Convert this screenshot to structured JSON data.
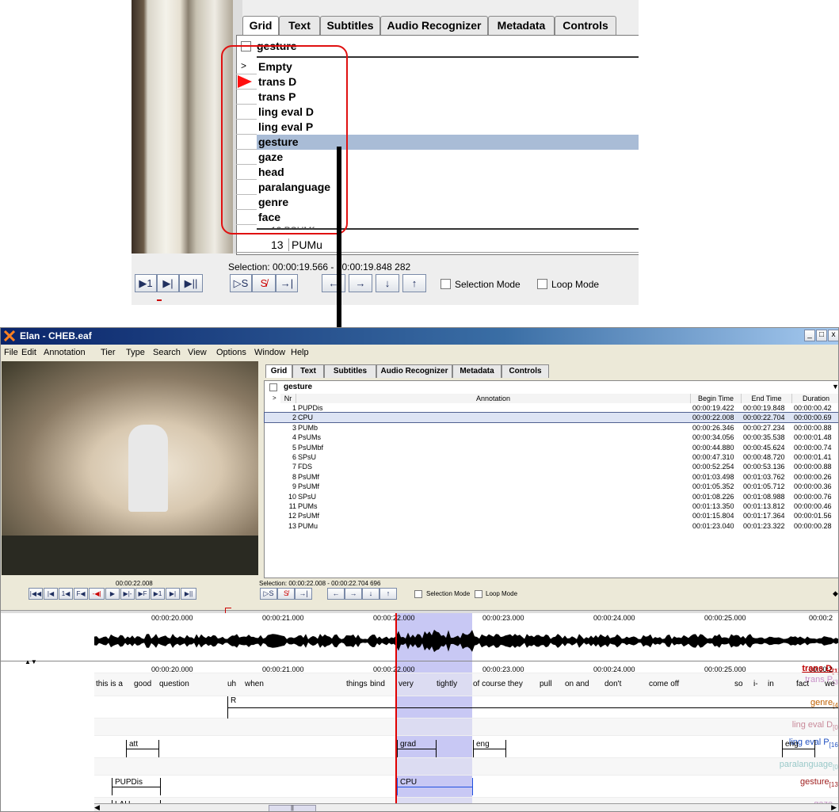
{
  "zoom": {
    "tabs": [
      "Grid",
      "Text",
      "Subtitles",
      "Audio Recognizer",
      "Metadata",
      "Controls"
    ],
    "tier_selected": "gesture",
    "list_first_marker": ">",
    "tier_list": [
      "Empty",
      "trans D",
      "trans P",
      "ling eval D",
      "ling eval P",
      "gesture",
      "gaze",
      "head",
      "paralanguage",
      "genre",
      "face"
    ],
    "highlight_index": 5,
    "partial_row": "12 PSUMf",
    "last_row_nr": "13",
    "last_row_ann": "PUMu",
    "selection": "Selection: 00:00:19.566 - 00:00:19.848  282",
    "nav_buttons": [
      "▶1",
      "▶|",
      "▶||"
    ],
    "sel_buttons": [
      "▷S",
      "S̸",
      "→|"
    ],
    "arrow_buttons": [
      "←",
      "→",
      "↓",
      "↑"
    ],
    "selection_mode": "Selection Mode",
    "loop_mode": "Loop Mode"
  },
  "window": {
    "title": "Elan - CHEB.eaf",
    "win_buttons": [
      "_",
      "□",
      "x"
    ],
    "menu": [
      "File",
      "Edit",
      "Annotation",
      "Tier",
      "Type",
      "Search",
      "View",
      "Options",
      "Window",
      "Help"
    ],
    "tabs": [
      "Grid",
      "Text",
      "Subtitles",
      "Audio Recognizer",
      "Metadata",
      "Controls"
    ],
    "tier_selected": "gesture",
    "headers": [
      "Nr",
      "Annotation",
      "Begin Time",
      "End Time",
      "Duration"
    ],
    "rows": [
      {
        "nr": "1",
        "ann": "PUPDis",
        "begin": "00:00:19.422",
        "end": "00:00:19.848",
        "dur": "00:00:00.42"
      },
      {
        "nr": "2",
        "ann": "CPU",
        "begin": "00:00:22.008",
        "end": "00:00:22.704",
        "dur": "00:00:00.69"
      },
      {
        "nr": "3",
        "ann": "PUMb",
        "begin": "00:00:26.346",
        "end": "00:00:27.234",
        "dur": "00:00:00.88"
      },
      {
        "nr": "4",
        "ann": "PsUMs",
        "begin": "00:00:34.056",
        "end": "00:00:35.538",
        "dur": "00:00:01.48"
      },
      {
        "nr": "5",
        "ann": "PsUMbf",
        "begin": "00:00:44.880",
        "end": "00:00:45.624",
        "dur": "00:00:00.74"
      },
      {
        "nr": "6",
        "ann": "SPsU",
        "begin": "00:00:47.310",
        "end": "00:00:48.720",
        "dur": "00:00:01.41"
      },
      {
        "nr": "7",
        "ann": "FDS",
        "begin": "00:00:52.254",
        "end": "00:00:53.136",
        "dur": "00:00:00.88"
      },
      {
        "nr": "8",
        "ann": "PsUMf",
        "begin": "00:01:03.498",
        "end": "00:01:03.762",
        "dur": "00:00:00.26"
      },
      {
        "nr": "9",
        "ann": "PsUMf",
        "begin": "00:01:05.352",
        "end": "00:01:05.712",
        "dur": "00:00:00.36"
      },
      {
        "nr": "10",
        "ann": "SPsU",
        "begin": "00:01:08.226",
        "end": "00:01:08.988",
        "dur": "00:00:00.76"
      },
      {
        "nr": "11",
        "ann": "PUMs",
        "begin": "00:01:13.350",
        "end": "00:01:13.812",
        "dur": "00:00:00.46"
      },
      {
        "nr": "12",
        "ann": "PsUMf",
        "begin": "00:01:15.804",
        "end": "00:01:17.364",
        "dur": "00:00:01.56"
      },
      {
        "nr": "13",
        "ann": "PUMu",
        "begin": "00:01:23.040",
        "end": "00:01:23.322",
        "dur": "00:00:00.28"
      }
    ],
    "current_time": "00:00:22.008",
    "selection": "Selection: 00:00:22.008 - 00:00:22.704  696",
    "player_buttons": [
      "|◀◀",
      "|◀",
      "1◀",
      "F◀",
      "-◀|",
      "▶",
      "▶|-",
      "▶F",
      "▶1",
      "▶|",
      "▶||"
    ],
    "sel_buttons": [
      "▷S",
      "S̸",
      "→|"
    ],
    "arrow_buttons": [
      "←",
      "→",
      "↓",
      "↑"
    ],
    "selection_mode": "Selection Mode",
    "loop_mode": "Loop Mode",
    "ruler_times": [
      "00:00:20.000",
      "00:00:21.000",
      "00:00:22.000",
      "00:00:23.000",
      "00:00:24.000",
      "00:00:25.000",
      "00:00:2"
    ],
    "tier_ruler_times": [
      "00:00:20.000",
      "00:00:21.000",
      "00:00:22.000",
      "00:00:23.000",
      "00:00:24.000",
      "00:00:25.000",
      "00:00:2"
    ],
    "tiers": [
      {
        "name": "trans D",
        "count": "[1]",
        "color": "#c00000"
      },
      {
        "name": "trans P",
        "count": "[3]",
        "color": "#a030a0"
      },
      {
        "name": "genre",
        "count": "[4]",
        "color": "#c06000"
      },
      {
        "name": "ling eval D",
        "count": "[0]",
        "color": "#a02040"
      },
      {
        "name": "ling eval P",
        "count": "[16]",
        "color": "#2050c0"
      },
      {
        "name": "paralanguage",
        "count": "[0]",
        "color": "#40a0a0"
      },
      {
        "name": "gesture",
        "count": "[13]",
        "color": "#a02020"
      },
      {
        "name": "gaze",
        "count": "[1]",
        "color": "#a040a0"
      },
      {
        "name": "head",
        "count": "",
        "color": "#804020"
      }
    ],
    "trans_words": [
      "this is a",
      "good",
      "question",
      "uh",
      "when",
      "things",
      "bind",
      "very",
      "tightly",
      "of course they",
      "pull",
      "on and",
      "don't",
      "come off",
      "so",
      "i-",
      "in",
      "fact",
      "we"
    ],
    "genre_ann": "R",
    "ling_p_anns": [
      "att",
      "grad",
      "eng",
      "eng"
    ],
    "gesture_anns": [
      "PUPDis",
      "CPU"
    ],
    "gaze_anns": [
      "LAU"
    ],
    "scroll_left": "◀",
    "scroll_right": "▶",
    "scroll_thumb": "||"
  }
}
